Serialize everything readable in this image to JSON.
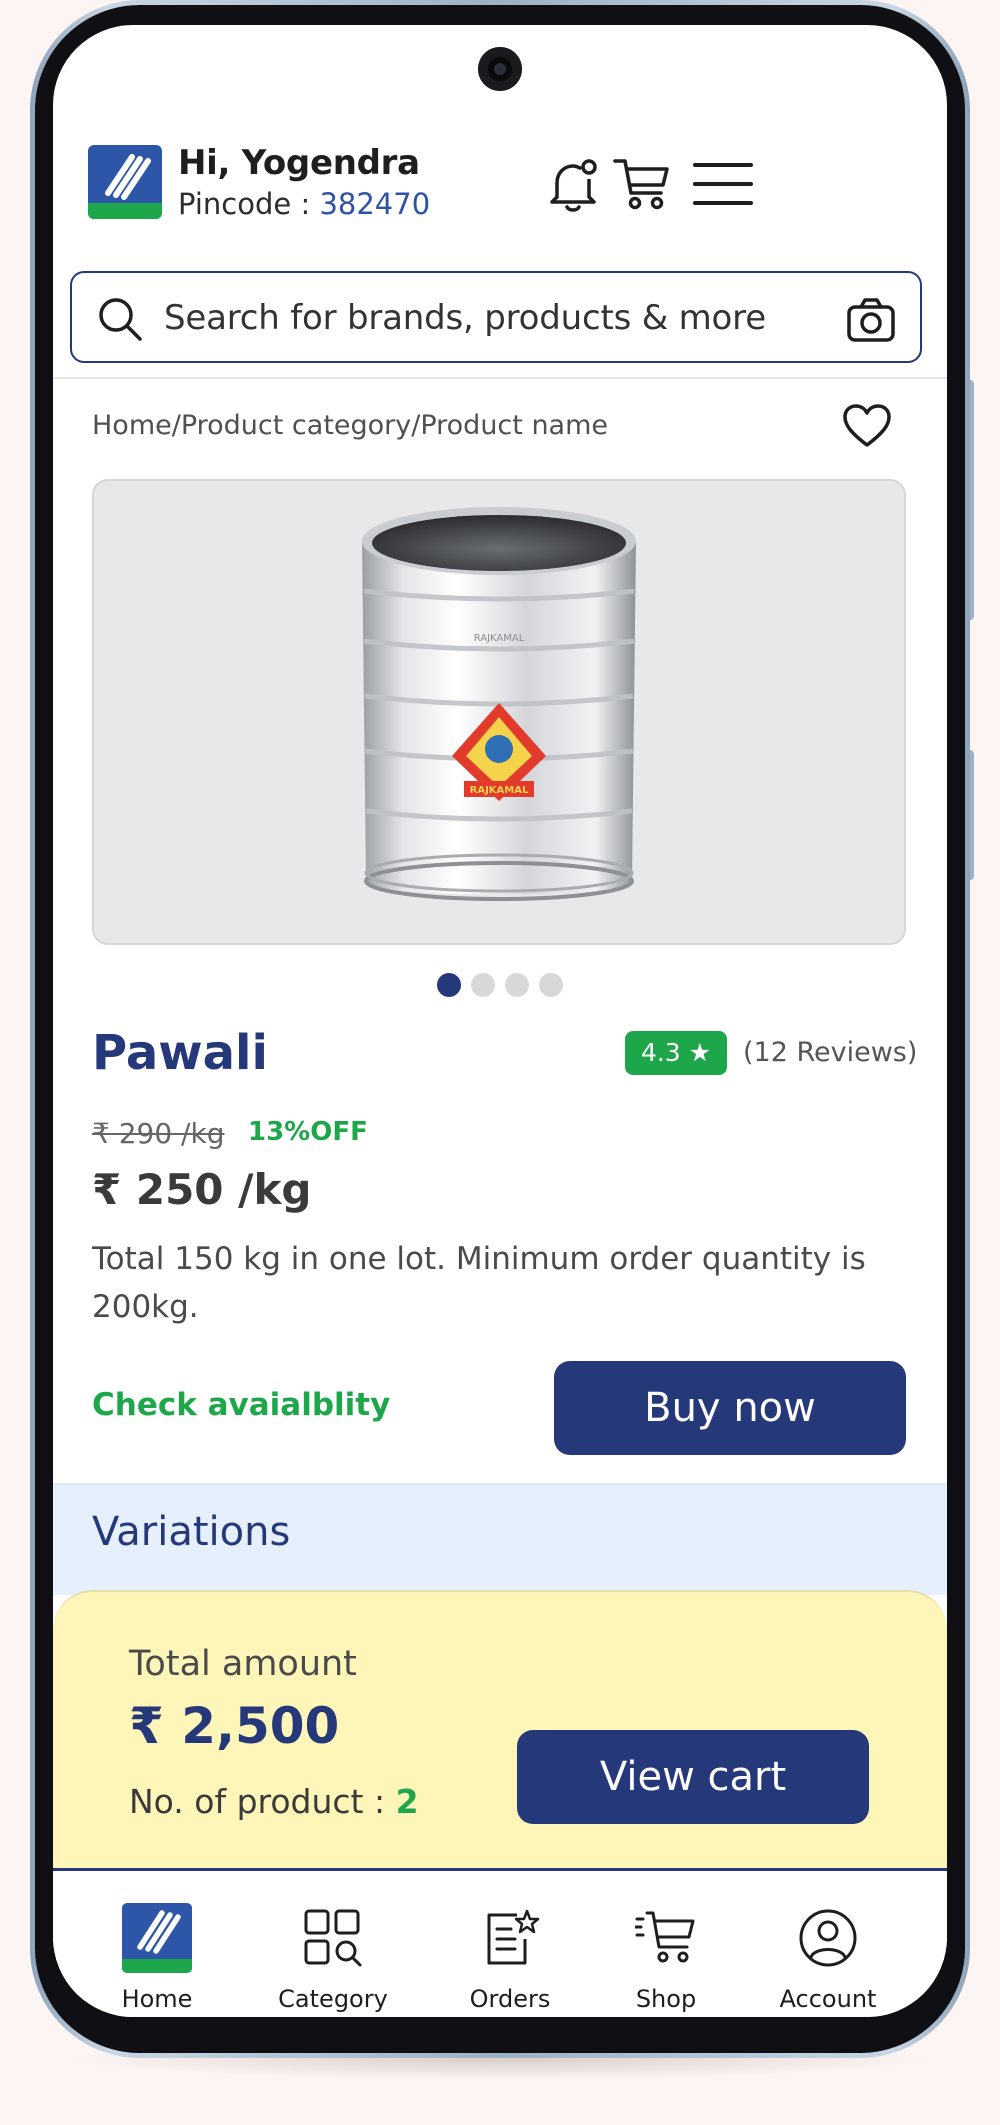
{
  "header": {
    "greeting": "Hi, Yogendra",
    "pincode_label": "Pincode : ",
    "pincode_value": "382470",
    "icons": [
      "logo-icon",
      "bell-icon",
      "cart-icon",
      "menu-icon"
    ]
  },
  "search": {
    "placeholder": "Search for brands, products & more",
    "icons": [
      "search-icon",
      "camera-icon"
    ]
  },
  "breadcrumb": "Home/Product category/Product name",
  "product": {
    "image_slides": 4,
    "active_slide": 1,
    "name": "Pawali",
    "rating": "4.3 ★",
    "reviews": "(12 Reviews)",
    "old_price": "₹ 290 /kg",
    "discount": "13%OFF",
    "price": "₹ 250 /kg",
    "description": "Total 150 kg in one lot. Minimum order quantity is 200kg.",
    "check_label": "Check avaialblity",
    "buy_label": "Buy now"
  },
  "variations": {
    "title": "Variations"
  },
  "cart_summary": {
    "total_label": "Total amount",
    "total_value": "₹ 2,500",
    "products_label": "No. of product : ",
    "products_count": "2",
    "view_cart_label": "View cart"
  },
  "bottom_nav": {
    "items": [
      {
        "label": "Home",
        "icon": "home-logo-icon"
      },
      {
        "label": "Category",
        "icon": "category-icon"
      },
      {
        "label": "Orders",
        "icon": "orders-icon"
      },
      {
        "label": "Shop",
        "icon": "shop-cart-icon"
      },
      {
        "label": "Account",
        "icon": "account-icon"
      }
    ]
  },
  "colors": {
    "primary": "#24387a",
    "accent_green": "#1da74a",
    "variations_bg": "#e6f0fd",
    "summary_bg": "#fef6b8"
  }
}
